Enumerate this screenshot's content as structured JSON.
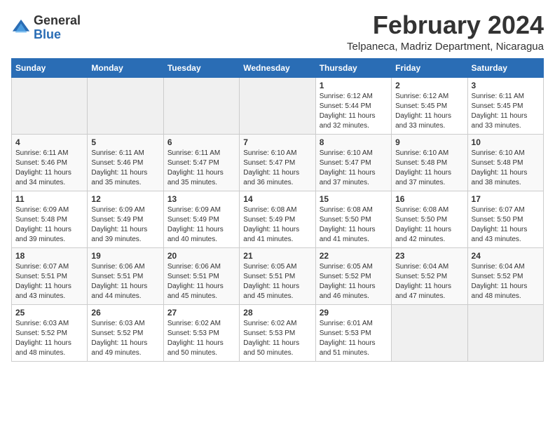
{
  "logo": {
    "general": "General",
    "blue": "Blue"
  },
  "title": "February 2024",
  "subtitle": "Telpaneca, Madriz Department, Nicaragua",
  "days_of_week": [
    "Sunday",
    "Monday",
    "Tuesday",
    "Wednesday",
    "Thursday",
    "Friday",
    "Saturday"
  ],
  "weeks": [
    {
      "days": [
        {
          "num": "",
          "info": ""
        },
        {
          "num": "",
          "info": ""
        },
        {
          "num": "",
          "info": ""
        },
        {
          "num": "",
          "info": ""
        },
        {
          "num": "1",
          "info": "Sunrise: 6:12 AM\nSunset: 5:44 PM\nDaylight: 11 hours\nand 32 minutes."
        },
        {
          "num": "2",
          "info": "Sunrise: 6:12 AM\nSunset: 5:45 PM\nDaylight: 11 hours\nand 33 minutes."
        },
        {
          "num": "3",
          "info": "Sunrise: 6:11 AM\nSunset: 5:45 PM\nDaylight: 11 hours\nand 33 minutes."
        }
      ]
    },
    {
      "days": [
        {
          "num": "4",
          "info": "Sunrise: 6:11 AM\nSunset: 5:46 PM\nDaylight: 11 hours\nand 34 minutes."
        },
        {
          "num": "5",
          "info": "Sunrise: 6:11 AM\nSunset: 5:46 PM\nDaylight: 11 hours\nand 35 minutes."
        },
        {
          "num": "6",
          "info": "Sunrise: 6:11 AM\nSunset: 5:47 PM\nDaylight: 11 hours\nand 35 minutes."
        },
        {
          "num": "7",
          "info": "Sunrise: 6:10 AM\nSunset: 5:47 PM\nDaylight: 11 hours\nand 36 minutes."
        },
        {
          "num": "8",
          "info": "Sunrise: 6:10 AM\nSunset: 5:47 PM\nDaylight: 11 hours\nand 37 minutes."
        },
        {
          "num": "9",
          "info": "Sunrise: 6:10 AM\nSunset: 5:48 PM\nDaylight: 11 hours\nand 37 minutes."
        },
        {
          "num": "10",
          "info": "Sunrise: 6:10 AM\nSunset: 5:48 PM\nDaylight: 11 hours\nand 38 minutes."
        }
      ]
    },
    {
      "days": [
        {
          "num": "11",
          "info": "Sunrise: 6:09 AM\nSunset: 5:48 PM\nDaylight: 11 hours\nand 39 minutes."
        },
        {
          "num": "12",
          "info": "Sunrise: 6:09 AM\nSunset: 5:49 PM\nDaylight: 11 hours\nand 39 minutes."
        },
        {
          "num": "13",
          "info": "Sunrise: 6:09 AM\nSunset: 5:49 PM\nDaylight: 11 hours\nand 40 minutes."
        },
        {
          "num": "14",
          "info": "Sunrise: 6:08 AM\nSunset: 5:49 PM\nDaylight: 11 hours\nand 41 minutes."
        },
        {
          "num": "15",
          "info": "Sunrise: 6:08 AM\nSunset: 5:50 PM\nDaylight: 11 hours\nand 41 minutes."
        },
        {
          "num": "16",
          "info": "Sunrise: 6:08 AM\nSunset: 5:50 PM\nDaylight: 11 hours\nand 42 minutes."
        },
        {
          "num": "17",
          "info": "Sunrise: 6:07 AM\nSunset: 5:50 PM\nDaylight: 11 hours\nand 43 minutes."
        }
      ]
    },
    {
      "days": [
        {
          "num": "18",
          "info": "Sunrise: 6:07 AM\nSunset: 5:51 PM\nDaylight: 11 hours\nand 43 minutes."
        },
        {
          "num": "19",
          "info": "Sunrise: 6:06 AM\nSunset: 5:51 PM\nDaylight: 11 hours\nand 44 minutes."
        },
        {
          "num": "20",
          "info": "Sunrise: 6:06 AM\nSunset: 5:51 PM\nDaylight: 11 hours\nand 45 minutes."
        },
        {
          "num": "21",
          "info": "Sunrise: 6:05 AM\nSunset: 5:51 PM\nDaylight: 11 hours\nand 45 minutes."
        },
        {
          "num": "22",
          "info": "Sunrise: 6:05 AM\nSunset: 5:52 PM\nDaylight: 11 hours\nand 46 minutes."
        },
        {
          "num": "23",
          "info": "Sunrise: 6:04 AM\nSunset: 5:52 PM\nDaylight: 11 hours\nand 47 minutes."
        },
        {
          "num": "24",
          "info": "Sunrise: 6:04 AM\nSunset: 5:52 PM\nDaylight: 11 hours\nand 48 minutes."
        }
      ]
    },
    {
      "days": [
        {
          "num": "25",
          "info": "Sunrise: 6:03 AM\nSunset: 5:52 PM\nDaylight: 11 hours\nand 48 minutes."
        },
        {
          "num": "26",
          "info": "Sunrise: 6:03 AM\nSunset: 5:52 PM\nDaylight: 11 hours\nand 49 minutes."
        },
        {
          "num": "27",
          "info": "Sunrise: 6:02 AM\nSunset: 5:53 PM\nDaylight: 11 hours\nand 50 minutes."
        },
        {
          "num": "28",
          "info": "Sunrise: 6:02 AM\nSunset: 5:53 PM\nDaylight: 11 hours\nand 50 minutes."
        },
        {
          "num": "29",
          "info": "Sunrise: 6:01 AM\nSunset: 5:53 PM\nDaylight: 11 hours\nand 51 minutes."
        },
        {
          "num": "",
          "info": ""
        },
        {
          "num": "",
          "info": ""
        }
      ]
    }
  ]
}
